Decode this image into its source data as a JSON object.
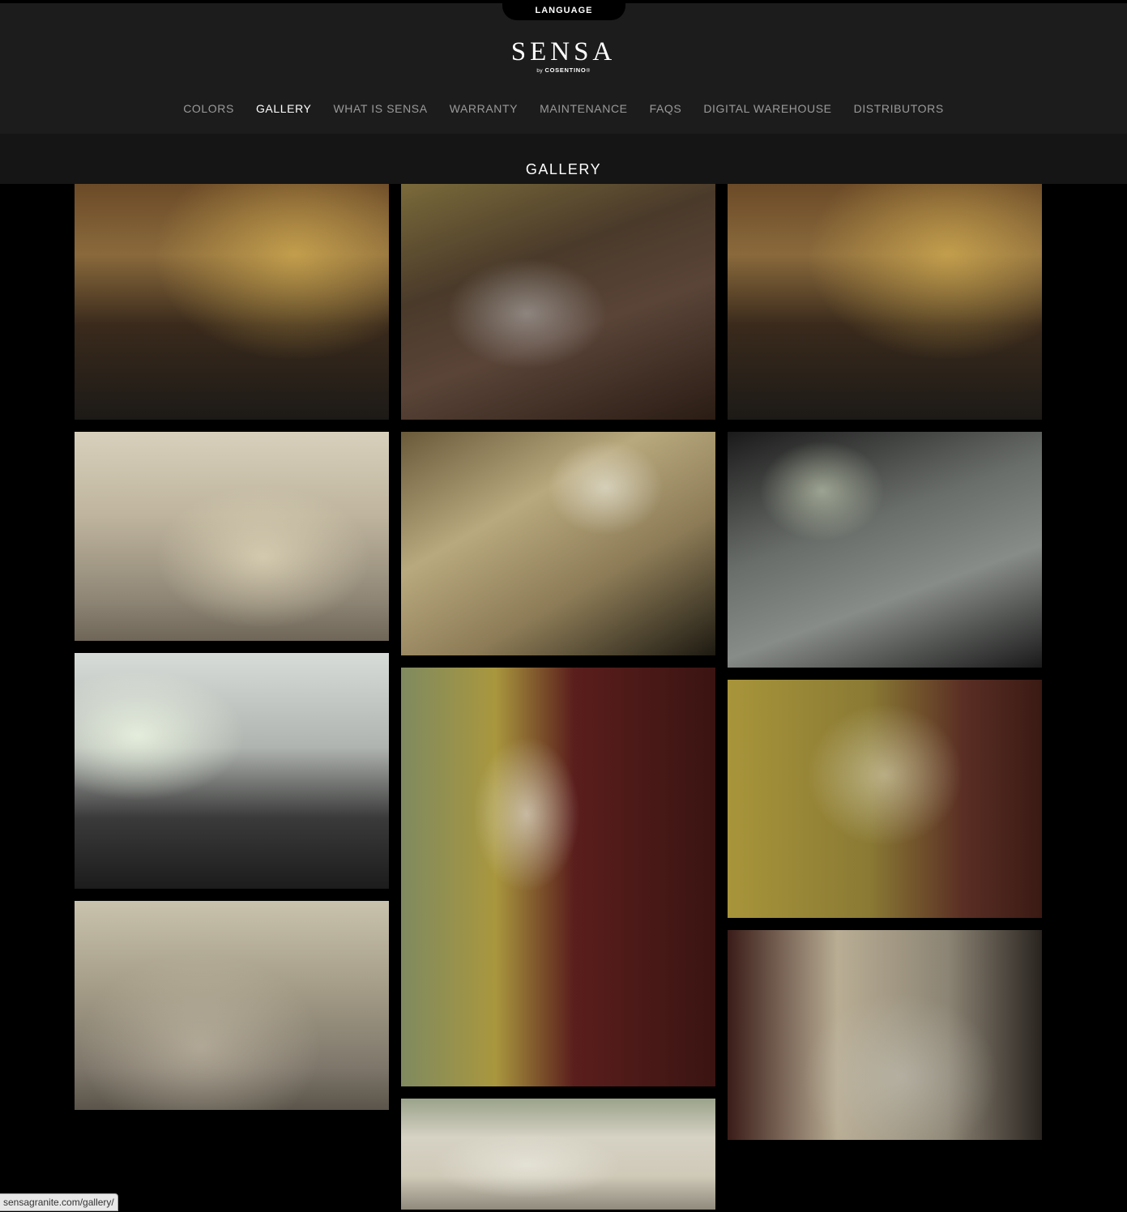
{
  "header": {
    "language_label": "LANGUAGE",
    "logo_text": "SENSA",
    "logo_by": "by",
    "logo_brand": "COSENTINO",
    "logo_reg": "®"
  },
  "nav": {
    "items": [
      "COLORS",
      "GALLERY",
      "WHAT IS SENSA",
      "WARRANTY",
      "MAINTENANCE",
      "FAQS",
      "DIGITAL WAREHOUSE",
      "DISTRIBUTORS"
    ],
    "active": "GALLERY"
  },
  "page": {
    "title": "GALLERY"
  },
  "gallery": {
    "images": [
      "kitchen-dark-wood-range-hood",
      "granite-sink-corner-closeup",
      "kitchen-dark-wood-range-hood",
      "white-kitchen-island",
      "dessert-cups-granite-edge",
      "martini-glasses-granite-edge",
      "modern-kitchen-island",
      "bathroom-vanity-closeup",
      "bathroom-yellow-walls",
      "kitchen-fruit-bowl-island",
      "kitchen-pendant-lights",
      "windowsill-vase-plant"
    ]
  },
  "status_bar": {
    "url": "sensagranite.com/gallery/"
  }
}
